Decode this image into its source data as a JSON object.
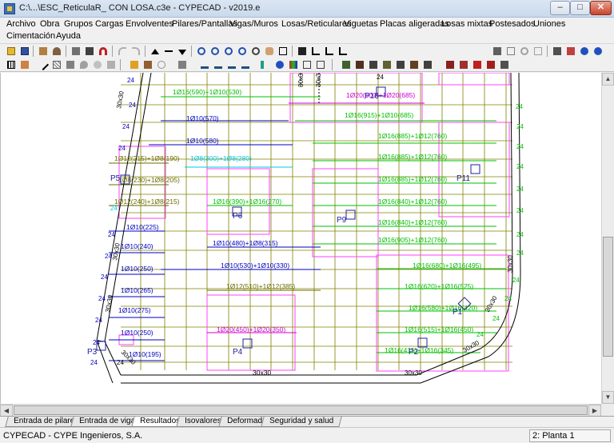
{
  "window": {
    "title": "C:\\...\\ESC_ReticulaR_ CON LOSA.c3e - CYPECAD - v2019.e",
    "minimize": "–",
    "maximize": "□",
    "close": "✕"
  },
  "menu": [
    "Archivo",
    "Obra",
    "Grupos",
    "Cargas",
    "Envolventes",
    "Pilares/Pantallas",
    "Vigas/Muros",
    "Losas/Reticulares",
    "Viguetas",
    "Placas aligeradas",
    "Losas mixtas",
    "Postesados",
    "Uniones",
    "Cimentación",
    "Ayuda"
  ],
  "toolbar1_icons": [
    "open-icon",
    "save-icon",
    "building-icon",
    "user-icon",
    "print-icon",
    "layers-icon",
    "magnet-icon",
    "undo-icon",
    "redo-icon",
    "arrow-up-icon",
    "arrow-updown-icon",
    "arrow-down-icon",
    "zoom-window-icon",
    "zoom-in-icon",
    "zoom-out-icon",
    "refresh-icon",
    "zoom-icon",
    "pan-icon",
    "redraw-icon",
    "views-icon",
    "axis-icon",
    "level-icon",
    "angle-icon",
    "print3d-icon",
    "copy-icon",
    "settings-icon",
    "info-icon",
    "camera-icon",
    "save-as-icon",
    "help-icon",
    "context-help-icon"
  ],
  "toolbar2_icons": [
    "grid-icon",
    "measure-icon",
    "line-icon",
    "hatch-icon",
    "drop-icon",
    "palette-icon",
    "flame-icon",
    "beam-edit-icon",
    "column-icon",
    "rebar-icon",
    "steel-icon",
    "triangle-icon",
    "bridge-icon",
    "pillar-icon",
    "info-icon",
    "colors-icon",
    "section-icon",
    "list-icon",
    "chart-icon",
    "table-icon",
    "results-icon",
    "check-icon",
    "cross-icon"
  ],
  "tabs": [
    "Entrada de pilares",
    "Entrada de vigas",
    "Resultados",
    "Isovalores",
    "Deformada",
    "Seguridad y salud"
  ],
  "active_tab": "Resultados",
  "status": {
    "left": "CYPECAD - CYPE Ingenieros, S.A.",
    "right": "2: Planta 1"
  },
  "drawing": {
    "colors": {
      "grid": "#808000",
      "rebar_green": "#00c000",
      "rebar_blue": "#0000c0",
      "rebar_magenta": "#d000d0",
      "rebar_cyan": "#00c8e8",
      "rebar_olive": "#6b6b00",
      "abacus": "#ff40ff",
      "pillar": "#2020a0",
      "slab_edge": "#000000"
    },
    "pillars": [
      {
        "label": "P10"
      },
      {
        "label": "P11"
      },
      {
        "label": "P5"
      },
      {
        "label": "P6"
      },
      {
        "label": "P9"
      },
      {
        "label": "P1"
      },
      {
        "label": "P3"
      },
      {
        "label": "P4"
      },
      {
        "label": "P2"
      }
    ],
    "beam_labels": [
      "30x30",
      "30x3",
      "30x3",
      "30x30",
      "30x30",
      "30x30",
      "30x30",
      "30x30",
      "30x30",
      "30x30"
    ],
    "rebar_labels": [
      {
        "text": "1Ø16(590)+1Ø10(530)",
        "color": "green"
      },
      {
        "text": "1Ø20(600)+1Ø20(685)",
        "color": "magenta"
      },
      {
        "text": "1Ø16(915)+1Ø10(685)",
        "color": "green"
      },
      {
        "text": "1Ø10(570)",
        "color": "blue"
      },
      {
        "text": "1Ø10(580)",
        "color": "blue"
      },
      {
        "text": "1Ø16(885)+1Ø12(760)",
        "color": "green"
      },
      {
        "text": "1Ø16(885)+1Ø12(760)",
        "color": "green"
      },
      {
        "text": "1Ø12(215)+1Ø8(190)",
        "color": "olive"
      },
      {
        "text": "1Ø8(300)+1Ø8(280)",
        "color": "cyan"
      },
      {
        "text": "1Ø16(885)+1Ø12(760)",
        "color": "green"
      },
      {
        "text": "1Ø8(230)+1Ø8(205)",
        "color": "olive"
      },
      {
        "text": "1Ø12(240)+1Ø8(215)",
        "color": "olive"
      },
      {
        "text": "1Ø16(390)+1Ø16(270)",
        "color": "green"
      },
      {
        "text": "1Ø16(840)+1Ø12(760)",
        "color": "green"
      },
      {
        "text": "1Ø16(840)+1Ø12(760)",
        "color": "green"
      },
      {
        "text": "1Ø10(225)",
        "color": "blue"
      },
      {
        "text": "1Ø16(905)+1Ø12(760)",
        "color": "green"
      },
      {
        "text": "1Ø10(480)+1Ø8(315)",
        "color": "blue"
      },
      {
        "text": "1Ø10(240)",
        "color": "blue"
      },
      {
        "text": "1Ø16(680)+1Ø16(495)",
        "color": "green"
      },
      {
        "text": "1Ø10(530)+1Ø10(330)",
        "color": "blue"
      },
      {
        "text": "1Ø10(250)",
        "color": "blue"
      },
      {
        "text": "1Ø16(620)+1Ø16(525)",
        "color": "green"
      },
      {
        "text": "1Ø12(510)+1Ø12(385)",
        "color": "olive"
      },
      {
        "text": "1Ø10(265)",
        "color": "blue"
      },
      {
        "text": "1Ø16(580)+1Ø16(420)",
        "color": "green"
      },
      {
        "text": "1Ø10(275)",
        "color": "blue"
      },
      {
        "text": "1Ø20(450)+1Ø20(350)",
        "color": "magenta"
      },
      {
        "text": "1Ø16(515)+1Ø16(450)",
        "color": "green"
      },
      {
        "text": "1Ø10(250)",
        "color": "blue"
      },
      {
        "text": "1Ø16(415)+1Ø16(345)",
        "color": "green"
      },
      {
        "text": "1Ø10(195)",
        "color": "blue"
      },
      {
        "text": "30x30",
        "color": "black"
      }
    ],
    "edge_marks": [
      "24",
      "24",
      "24",
      "24",
      "24",
      "24",
      "24",
      "24",
      "24",
      "24",
      "24",
      "24",
      "24",
      "24",
      "24",
      "24",
      "24",
      "24",
      "24",
      "24",
      "24",
      "24",
      "24",
      "24",
      "24",
      "24"
    ]
  }
}
